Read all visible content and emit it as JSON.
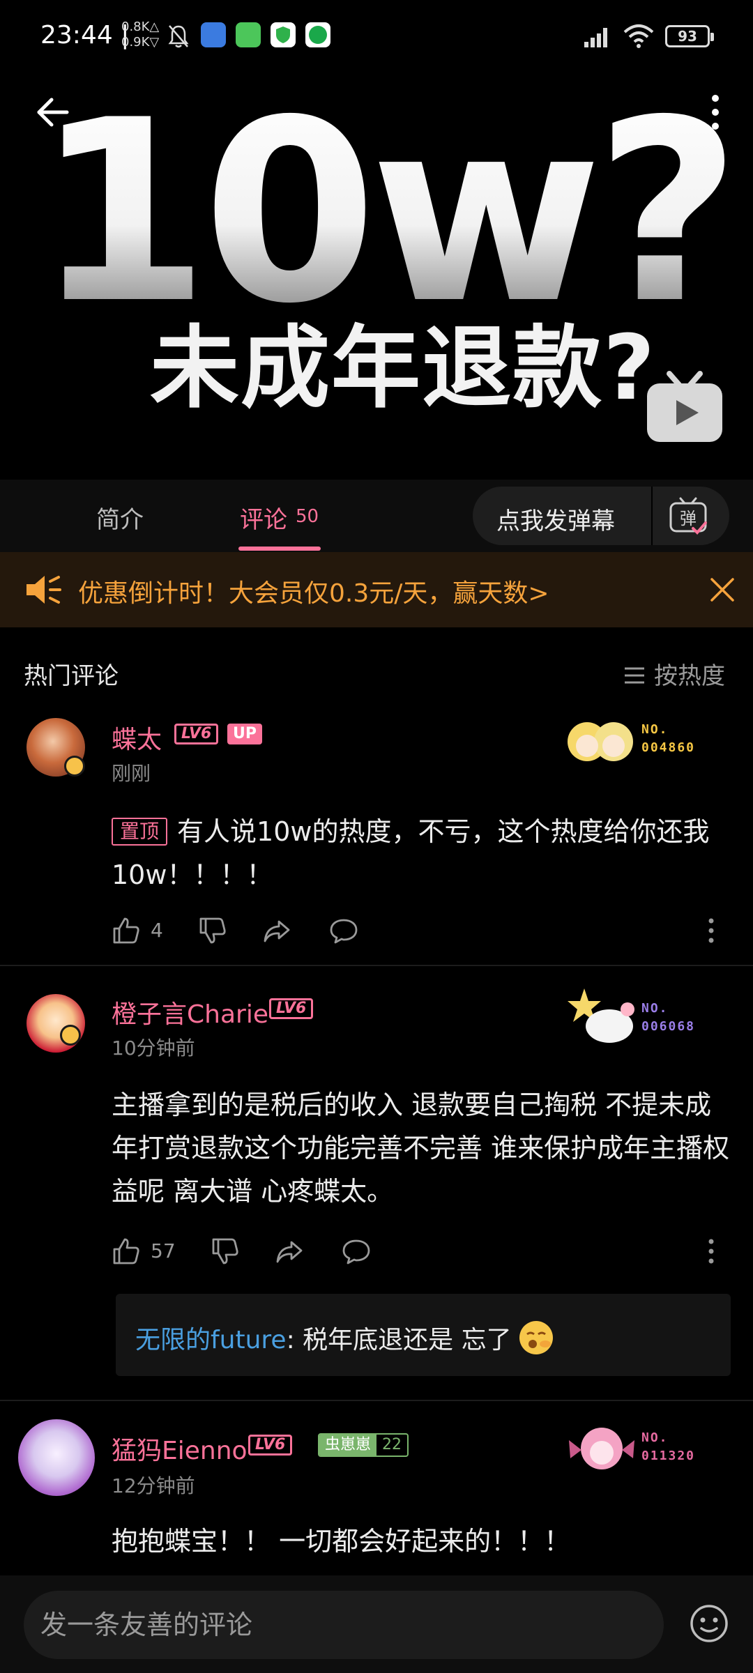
{
  "status_bar": {
    "time": "23:44 |",
    "up_speed": "0.8K△",
    "down_speed": "0.9K▽",
    "battery": "93"
  },
  "hero": {
    "big_text": "10w?",
    "sub_text": "未成年退款?"
  },
  "tabs": {
    "intro": "简介",
    "comments": "评论",
    "comment_count": "50",
    "danmu_button": "点我发弹幕",
    "danmu_icon_char": "弹"
  },
  "promo": {
    "text": "优惠倒计时！大会员仅0.3元/天，赢天数>"
  },
  "section": {
    "title": "热门评论",
    "sort_label": "按热度"
  },
  "comments": [
    {
      "username": "蝶太",
      "level": "LV6",
      "tag": "UP",
      "time": "刚刚",
      "fan_no_label": "NO.",
      "fan_no": "004860",
      "pin_label": "置顶",
      "text": "有人说10w的热度，不亏，这个热度给你还我10w！！！！",
      "likes": "4",
      "accent": "#f6c744"
    },
    {
      "username": "橙子言Charie",
      "level": "LV6",
      "time": "10分钟前",
      "fan_no_label": "NO.",
      "fan_no": "006068",
      "text": "主播拿到的是税后的收入 退款要自己掏税 不提未成年打赏退款这个功能完善不完善 谁来保护成年主播权益呢 离大谱 心疼蝶太。",
      "likes": "57",
      "accent": "#9a7ee8",
      "reply": {
        "name": "无限的future",
        "text": ": 税年底退还是 忘了"
      }
    },
    {
      "username": "猛犸Eienno",
      "level": "LV6",
      "time": "12分钟前",
      "medal_name": "虫崽崽",
      "medal_level": "22",
      "fan_no_label": "NO.",
      "fan_no": "011320",
      "text": "抱抱蝶宝！！ 一切都会好起来的！！！",
      "accent": "#e66aa0"
    }
  ],
  "bottom": {
    "placeholder": "发一条友善的评论"
  },
  "colors": {
    "brand_pink": "#fb7299",
    "promo_orange": "#f6a33c",
    "link_blue": "#4a9fe0"
  }
}
